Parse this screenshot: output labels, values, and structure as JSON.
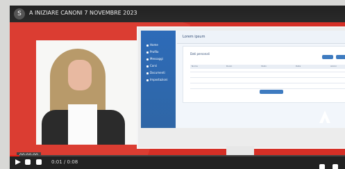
{
  "video": {
    "title": "A INIZIARE CANONI 7 NOVEMBRE 2023",
    "channel_initial": "S",
    "caption": "00:00:00",
    "time": "0:01 / 0:08",
    "progress_fraction": 0.03
  },
  "app": {
    "header_title": "Lorem ipsum",
    "panel_title": "Dati personali",
    "sidebar": [
      {
        "label": "Home"
      },
      {
        "label": "Profilo"
      },
      {
        "label": "Messaggi"
      },
      {
        "label": "Corsi"
      },
      {
        "label": "Documenti"
      },
      {
        "label": "Impostazioni"
      }
    ],
    "table": {
      "headers": [
        "Nome",
        "Ruolo",
        "Stato",
        "Data",
        "Azioni"
      ],
      "rows": [
        [
          "",
          "",
          "",
          "",
          ""
        ],
        [
          "",
          "",
          "",
          "",
          ""
        ],
        [
          "",
          "",
          "",
          "",
          ""
        ],
        [
          "",
          "",
          "",
          "",
          ""
        ]
      ]
    },
    "cta_label": ""
  },
  "colors": {
    "accent": "#e62117",
    "brand": "#2d6bb8",
    "background": "#d52f26"
  }
}
